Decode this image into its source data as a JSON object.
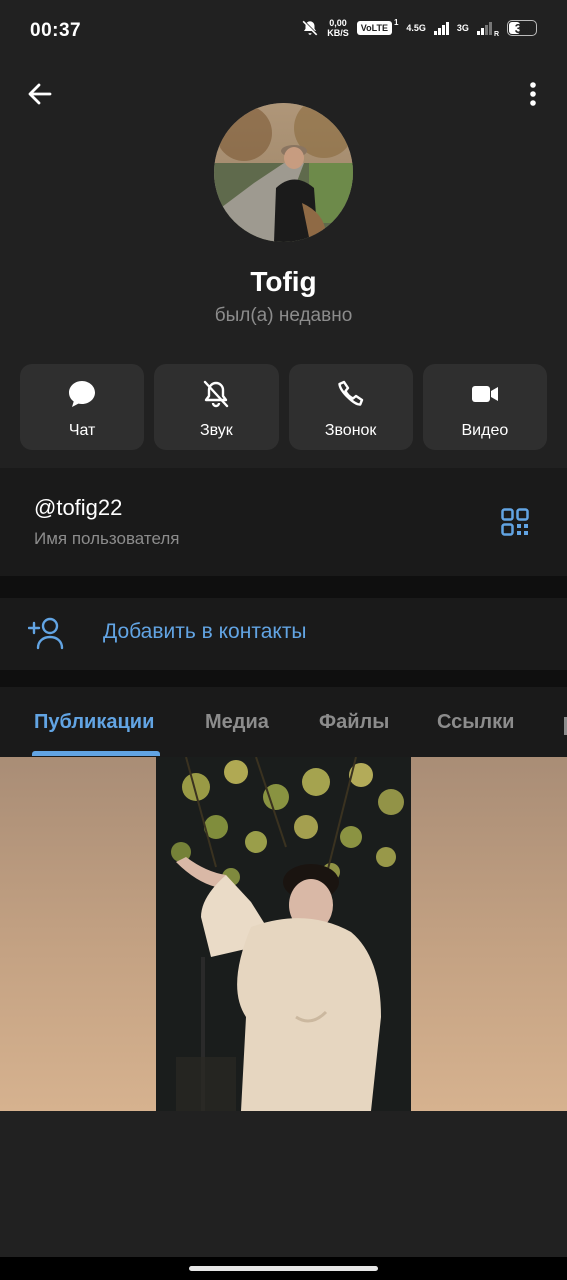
{
  "status_bar": {
    "time": "00:37",
    "net_speed_value": "0,00",
    "net_speed_unit": "KB/S",
    "volte": "VoLTE",
    "sim1": "1",
    "network1": "4.5G",
    "network2": "3G",
    "roaming": "R",
    "battery": "39"
  },
  "profile": {
    "name": "Tofig",
    "last_seen": "был(а) недавно"
  },
  "actions": [
    {
      "label": "Чат",
      "icon": "chat-bubble-icon"
    },
    {
      "label": "Звук",
      "icon": "bell-off-icon"
    },
    {
      "label": "Звонок",
      "icon": "phone-icon"
    },
    {
      "label": "Видео",
      "icon": "video-camera-icon"
    }
  ],
  "info": {
    "username": "@tofig22",
    "username_label": "Имя пользователя"
  },
  "add_contact": {
    "label": "Добавить в контакты"
  },
  "tabs": [
    {
      "label": "Публикации",
      "active": true
    },
    {
      "label": "Медиа",
      "active": false
    },
    {
      "label": "Файлы",
      "active": false
    },
    {
      "label": "Ссылки",
      "active": false
    }
  ],
  "colors": {
    "background": "#212121",
    "section": "#1a1a1a",
    "accent": "#62a4e3",
    "secondary_text": "#8c8c8c",
    "button": "#2f2f2f"
  }
}
